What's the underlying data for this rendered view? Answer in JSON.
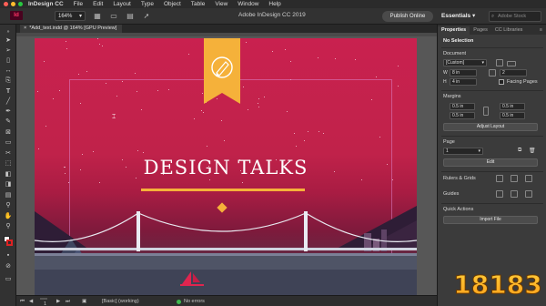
{
  "menubar": {
    "items": [
      "InDesign CC",
      "File",
      "Edit",
      "Layout",
      "Type",
      "Object",
      "Table",
      "View",
      "Window",
      "Help"
    ]
  },
  "appbar": {
    "zoom": "164%",
    "title": "Adobe InDesign CC 2019",
    "publish_label": "Publish Online",
    "workspace_label": "Essentials",
    "search_placeholder": "Adobe Stock"
  },
  "document": {
    "tab_label": "*Add_text.indd @ 164% [GPU Preview]",
    "headline": "DESIGN TALKS"
  },
  "panel": {
    "tabs": [
      "Properties",
      "Pages",
      "CC Libraries"
    ],
    "selection_label": "No Selection",
    "document_label": "Document",
    "preset_value": "[Custom]",
    "width_value": "8 in",
    "height_value": "4 in",
    "pages_value": "2",
    "facing_pages_label": "Facing Pages",
    "margins_label": "Margins",
    "margin_values": [
      "0.5 in",
      "0.5 in",
      "0.5 in",
      "0.5 in"
    ],
    "adjust_layout_label": "Adjust Layout",
    "page_label": "Page",
    "page_value": "1",
    "edit_page_label": "Edit",
    "rulers_grids_label": "Rulers & Grids",
    "guides_label": "Guides",
    "quick_actions_label": "Quick Actions",
    "import_file_label": "Import File"
  },
  "statusbar": {
    "page_number": "1",
    "style_value": "[Basic] (working)",
    "errors_label": "No errors"
  },
  "watermark": {
    "text": "18183"
  },
  "colors": {
    "accent_orange": "#f5b13a",
    "artboard_top": "#c9214f",
    "status_ok": "#3fb94f"
  },
  "icons": {
    "toolbar": [
      "selection-icon",
      "direct-selection-icon",
      "page-tool-icon",
      "gap-tool-icon",
      "content-collector-icon",
      "type-icon",
      "line-icon",
      "pen-icon",
      "pencil-icon",
      "rectangle-frame-icon",
      "rectangle-icon",
      "scissors-icon",
      "free-transform-icon",
      "gradient-swatch-icon",
      "gradient-feather-icon",
      "note-icon",
      "eyedropper-icon",
      "hand-icon",
      "zoom-icon",
      "fill-stroke-icon",
      "apply-color-icon",
      "screen-mode-icon"
    ]
  }
}
